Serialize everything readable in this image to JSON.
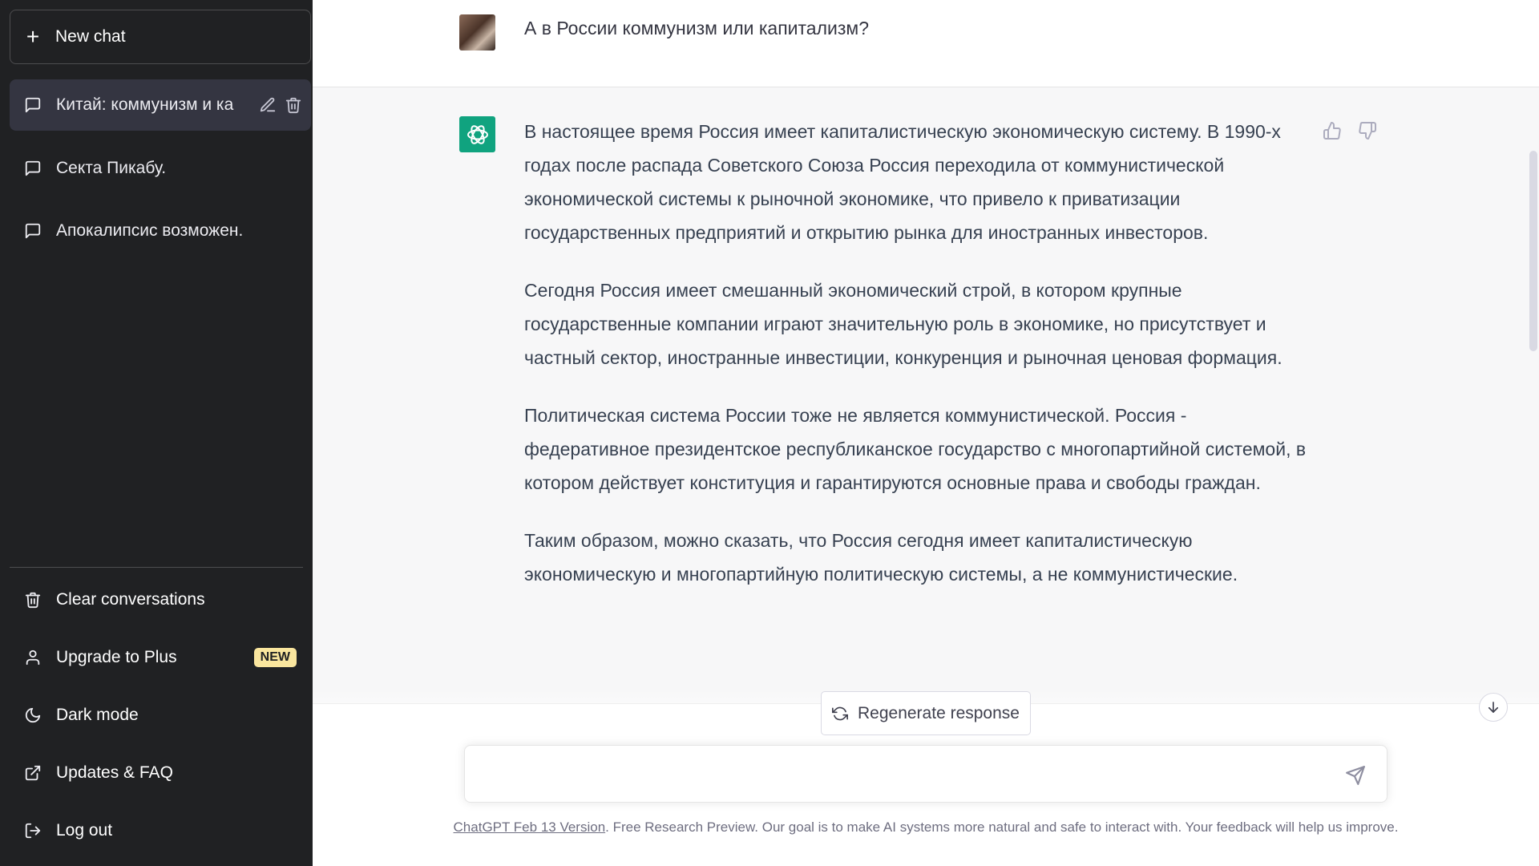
{
  "sidebar": {
    "new_chat": "New chat",
    "conversations": [
      {
        "label": "Китай: коммунизм и ка",
        "active": true
      },
      {
        "label": "Секта Пикабу.",
        "active": false
      },
      {
        "label": "Апокалипсис возможен.",
        "active": false
      }
    ],
    "menu": {
      "clear": "Clear conversations",
      "upgrade": "Upgrade to Plus",
      "upgrade_badge": "NEW",
      "dark_mode": "Dark mode",
      "updates": "Updates & FAQ",
      "logout": "Log out"
    }
  },
  "chat": {
    "user_message": "А в России коммунизм или капитализм?",
    "assistant_paragraphs": [
      "В настоящее время Россия имеет капиталистическую экономическую систему. В 1990-х годах после распада Советского Союза Россия переходила от коммунистической экономической системы к рыночной экономике, что привело к приватизации государственных предприятий и открытию рынка для иностранных инвесторов.",
      "Сегодня Россия имеет смешанный экономический строй, в котором крупные государственные компании играют значительную роль в экономике, но присутствует и частный сектор, иностранные инвестиции, конкуренция и рыночная ценовая формация.",
      "Политическая система России тоже не является коммунистической. Россия - федеративное президентское республиканское государство с многопартийной системой, в котором действует конституция и гарантируются основные права и свободы граждан.",
      "Таким образом, можно сказать, что Россия сегодня имеет капиталистическую экономическую и многопартийную политическую системы, а не коммунистические."
    ]
  },
  "composer": {
    "regenerate": "Regenerate response",
    "input_value": ""
  },
  "footer": {
    "version_link": "ChatGPT Feb 13 Version",
    "text": ". Free Research Preview. Our goal is to make AI systems more natural and safe to interact with. Your feedback will help us improve."
  },
  "colors": {
    "sidebar_bg": "#202123",
    "active_item_bg": "#343541",
    "assistant_bg": "#f7f7f8",
    "gpt_accent": "#10a37f",
    "badge_bg": "#fae69e"
  }
}
